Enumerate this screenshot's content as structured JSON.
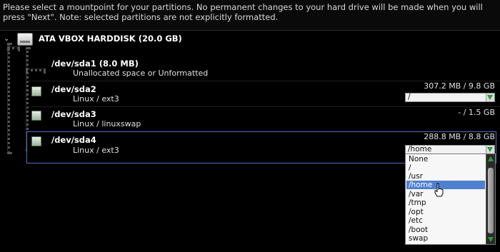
{
  "instructions": "Please select a mountpoint for your partitions. No permanent changes to your hard drive will be made when you will press \"Next\". Note: selected partitions are not explicitly formatted.",
  "disk": {
    "title": "ATA VBOX HARDDISK  (20.0 GB)"
  },
  "partitions": [
    {
      "name": "/dev/sda1  (8.0 MB)",
      "desc": "Unallocated space or Unformatted",
      "size": "",
      "mount": ""
    },
    {
      "name": "/dev/sda2",
      "desc": "Linux / ext3",
      "size": "307.2 MB / 9.8 GB",
      "mount": "/"
    },
    {
      "name": "/dev/sda3",
      "desc": "Linux / linuxswap",
      "size": "- / 1.5 GB",
      "mount": ""
    },
    {
      "name": "/dev/sda4",
      "desc": "Linux / ext3",
      "size": "288.8 MB / 8.8 GB",
      "mount": "/home"
    }
  ],
  "dropdown": {
    "options": [
      "None",
      "/",
      "/usr",
      "/home",
      "/var",
      "/tmp",
      "/opt",
      "/etc",
      "/boot",
      "swap"
    ],
    "highlighted": "/home"
  },
  "colors": {
    "selection_border": "#4a72c4",
    "highlight": "#4f7fcf",
    "arrow": "#2f9b2f"
  }
}
